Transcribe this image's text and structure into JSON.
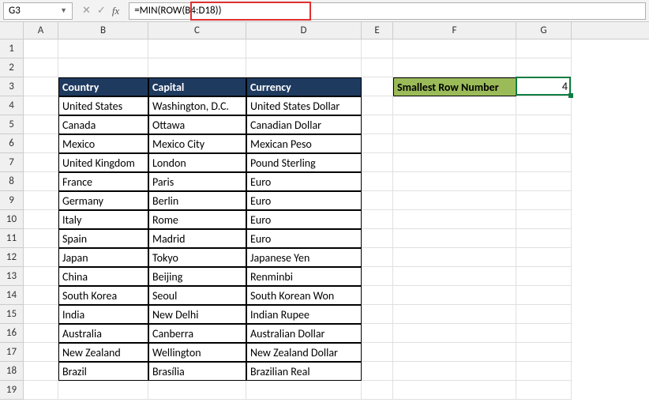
{
  "name_box": "G3",
  "formula": "=MIN(ROW(B4:D18))",
  "columns": [
    {
      "label": "A",
      "width": 44
    },
    {
      "label": "B",
      "width": 114
    },
    {
      "label": "C",
      "width": 124
    },
    {
      "label": "D",
      "width": 146
    },
    {
      "label": "E",
      "width": 40
    },
    {
      "label": "F",
      "width": 156
    },
    {
      "label": "G",
      "width": 70
    }
  ],
  "row_heights": {
    "default": 24
  },
  "num_rows": 19,
  "headers": {
    "b": "Country",
    "c": "Capital",
    "d": "Currency"
  },
  "table": [
    {
      "country": "United States",
      "capital": "Washington, D.C.",
      "currency": "United States Dollar"
    },
    {
      "country": "Canada",
      "capital": "Ottawa",
      "currency": "Canadian Dollar"
    },
    {
      "country": "Mexico",
      "capital": "Mexico City",
      "currency": "Mexican Peso"
    },
    {
      "country": "United Kingdom",
      "capital": "London",
      "currency": "Pound Sterling"
    },
    {
      "country": "France",
      "capital": "Paris",
      "currency": "Euro"
    },
    {
      "country": "Germany",
      "capital": "Berlin",
      "currency": "Euro"
    },
    {
      "country": "Italy",
      "capital": "Rome",
      "currency": "Euro"
    },
    {
      "country": "Spain",
      "capital": "Madrid",
      "currency": "Euro"
    },
    {
      "country": "Japan",
      "capital": "Tokyo",
      "currency": "Japanese Yen"
    },
    {
      "country": "China",
      "capital": "Beijing",
      "currency": "Renminbi"
    },
    {
      "country": "South Korea",
      "capital": "Seoul",
      "currency": "South Korean Won"
    },
    {
      "country": "India",
      "capital": "New Delhi",
      "currency": "Indian Rupee"
    },
    {
      "country": "Australia",
      "capital": "Canberra",
      "currency": "Australian Dollar"
    },
    {
      "country": "New Zealand",
      "capital": "Wellington",
      "currency": "New Zealand Dollar"
    },
    {
      "country": "Brazil",
      "capital": "Brasília",
      "currency": "Brazilian Real"
    }
  ],
  "result_label": "Smallest Row Number",
  "result_value": "4",
  "active_cell": "G3"
}
